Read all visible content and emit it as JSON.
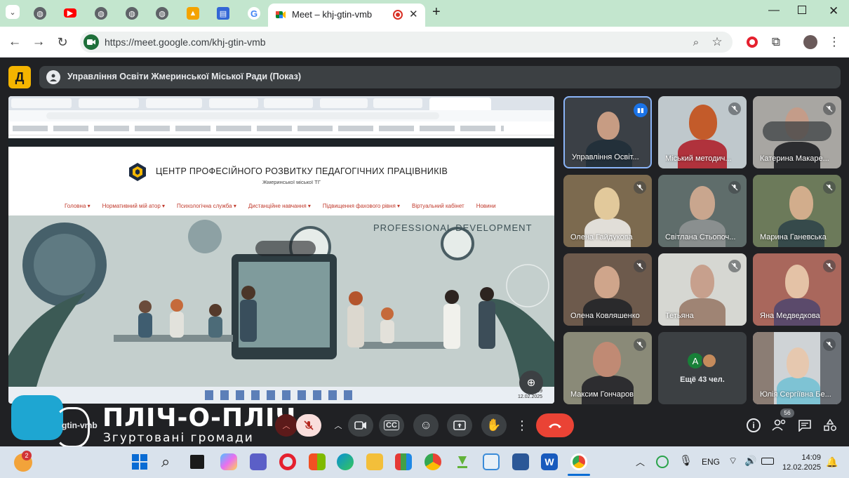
{
  "browser": {
    "active_tab_title": "Meet – khj-gtin-vmb",
    "url": "https://meet.google.com/khj-gtin-vmb"
  },
  "meet": {
    "presenter_label": "Управління Освіти Жмеринської Міської Ради (Показ)",
    "logo_letter": "Д",
    "meeting_code": "gtin-vmb",
    "more_count_label": "Ещё 43 чел.",
    "people_badge": "56",
    "tiles": [
      {
        "name": "Управління Освіт..."
      },
      {
        "name": "Міський методич..."
      },
      {
        "name": "Катерина Макаре..."
      },
      {
        "name": "Олена Гайдукова"
      },
      {
        "name": "Світлана Стьопоч..."
      },
      {
        "name": "Марина Ганевська"
      },
      {
        "name": "Олена Ковляшенко"
      },
      {
        "name": "Тетьяна"
      },
      {
        "name": "Яна Медведкова"
      },
      {
        "name": "Максим Гончаров"
      },
      {
        "name": "Юлія Сергіївна Бе..."
      }
    ]
  },
  "presentation": {
    "site_title": "ЦЕНТР ПРОФЕСІЙНОГО РОЗВИТКУ ПЕДАГОГІЧНИХ ПРАЦІВНИКІВ",
    "site_subtitle": "Жмеринської міської ТГ",
    "nav": [
      "Головна ▾",
      "Нормативний мій атор ▾",
      "Психологічна служба ▾",
      "Дистанційне навчання ▾",
      "Підвищення фахового рівня ▾",
      "Віртуальний кабінет",
      "Новини"
    ],
    "hero_text": "PROFESSIONAL DEVELOPMENT",
    "pres_time": "14:09",
    "pres_date": "12.02.2025"
  },
  "brand": {
    "title": "ПЛІЧ-О-ПЛІЧ",
    "subtitle": "Згуртовані громади"
  },
  "taskbar": {
    "notification_count": "2",
    "language": "ENG",
    "time": "14:09",
    "date": "12.02.2025"
  },
  "colors": {
    "tab_bar": "#c3e6ce",
    "meet_bg": "#202124",
    "end_call": "#ea4335",
    "brand_blue": "#1ea6d2"
  }
}
